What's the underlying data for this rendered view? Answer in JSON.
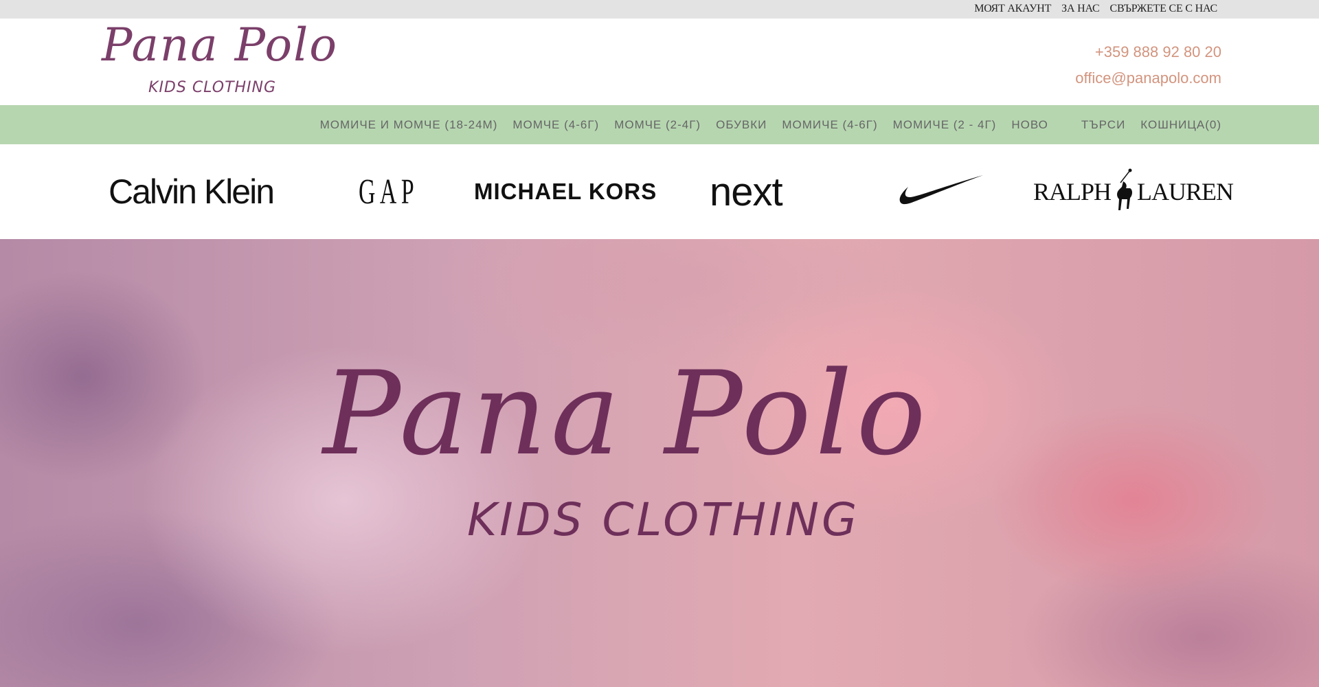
{
  "top_links": [
    "МОЯТ АКАУНТ",
    "ЗА НАС",
    "СВЪРЖЕТЕ СЕ С НАС"
  ],
  "logo": {
    "name": "Pana Polo",
    "subtitle": "KIDS CLOTHING"
  },
  "contact": {
    "phone": "+359 888 92 80 20",
    "email": "office@panapolo.com"
  },
  "nav": {
    "categories": [
      "МОМИЧЕ И МОМЧЕ (18-24М)",
      "МОМЧЕ (4-6Г)",
      "МОМЧЕ (2-4Г)",
      "ОБУВКИ",
      "МОМИЧЕ (4-6Г)",
      "МОМИЧЕ (2 - 4Г)",
      "НОВО"
    ],
    "search": "ТЪРСИ",
    "cart": "КОШНИЦА(0)"
  },
  "brands": {
    "calvin_klein": "Calvin Klein",
    "gap": "GAP",
    "michael_kors": "MICHAEL KORS",
    "next": "next",
    "nike": "nike-swoosh-logo",
    "ralph_lauren_left": "RALPH",
    "ralph_lauren_right": "LAUREN"
  },
  "hero": {
    "name": "Pana Polo",
    "subtitle": "KIDS CLOTHING"
  },
  "colors": {
    "brand_plum": "#7b3f6a",
    "nav_green": "#b6d6b0",
    "contact_peach": "#d2947e",
    "topbar_gray": "#e3e3e3"
  }
}
